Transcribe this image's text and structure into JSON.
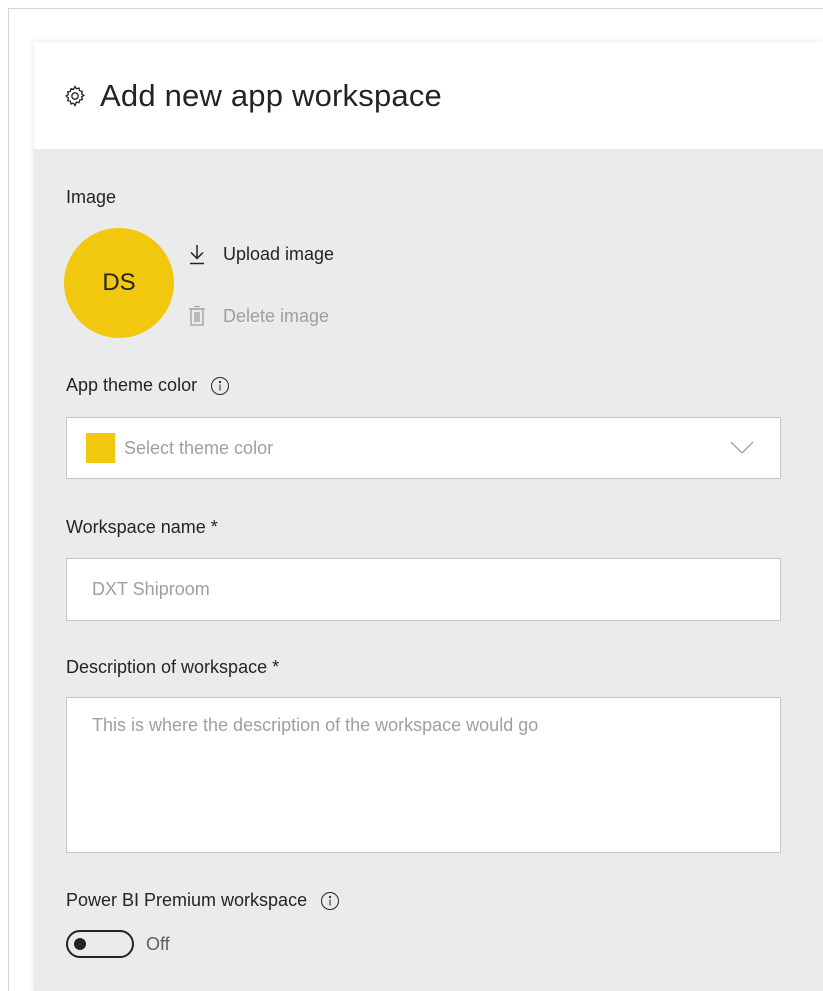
{
  "panel": {
    "title": "Add new app workspace"
  },
  "image_section": {
    "label": "Image",
    "avatar_initials": "DS",
    "avatar_color": "#f2c80f",
    "upload_label": "Upload image",
    "delete_label": "Delete image"
  },
  "theme": {
    "label": "App theme color",
    "placeholder": "Select theme color",
    "selected_color": "#f2c80f"
  },
  "workspace_name": {
    "label": "Workspace name *",
    "placeholder": "DXT Shiproom",
    "value": ""
  },
  "description": {
    "label": "Description of workspace *",
    "placeholder": "This is where the description of the workspace would go",
    "value": ""
  },
  "premium": {
    "label": "Power BI Premium workspace",
    "state_label": "Off",
    "enabled": false
  },
  "icons": {
    "header": "gear-icon",
    "upload": "download-arrow-icon",
    "delete": "trash-icon",
    "info": "info-icon",
    "dropdown": "chevron-down-icon"
  }
}
